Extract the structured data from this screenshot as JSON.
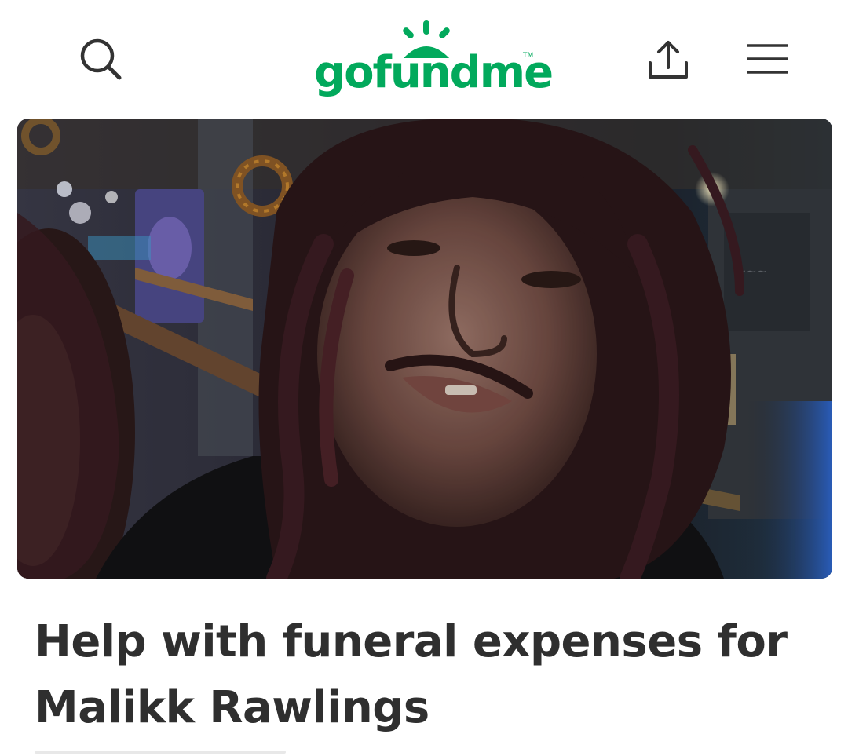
{
  "header": {
    "search_icon": "search-icon",
    "share_icon": "share-icon",
    "menu_icon": "hamburger-menu-icon",
    "logo_text": "gofundme",
    "logo_trademark": "TM"
  },
  "campaign": {
    "image": "campaign-photo",
    "title_line1": "Help with funeral expenses for",
    "title_line2": "Malikk Rawlings"
  },
  "colors": {
    "brand_green": "#02a95c",
    "title_text": "#2f2f2f",
    "icon_stroke": "#333333"
  }
}
